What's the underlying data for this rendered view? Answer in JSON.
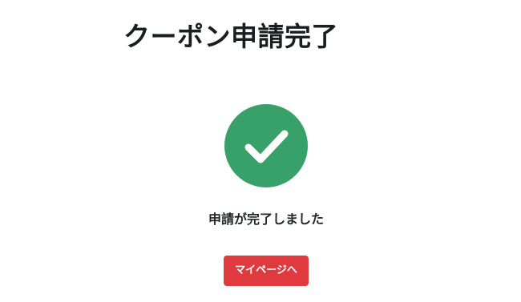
{
  "page": {
    "title": "クーポン申請完了",
    "message": "申請が完了しました"
  },
  "status": {
    "icon": "check-circle-icon",
    "color": "#38a169"
  },
  "actions": {
    "mypage_label": "マイページへ",
    "button_color": "#e0393e"
  }
}
